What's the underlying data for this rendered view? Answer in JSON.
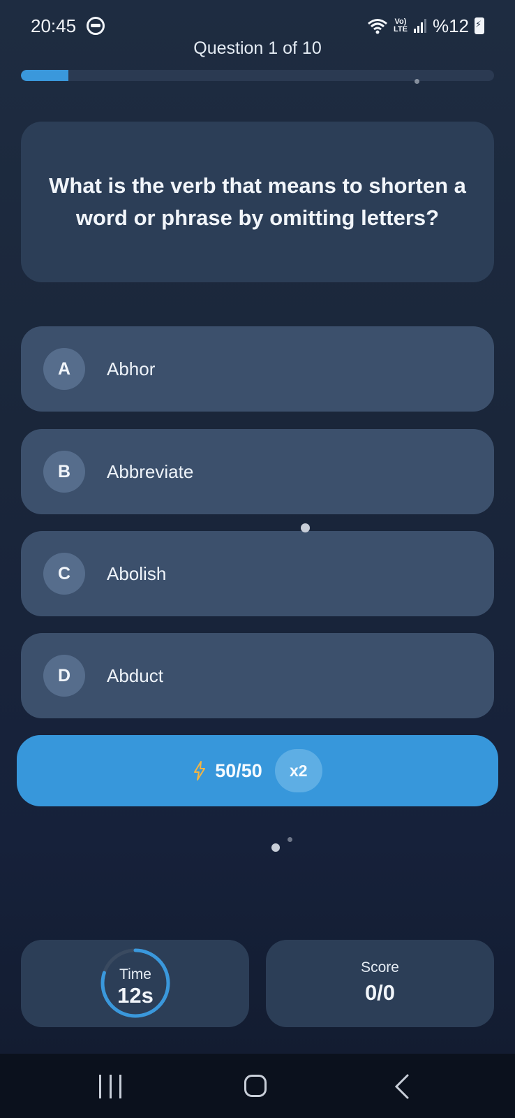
{
  "status_bar": {
    "time": "20:45",
    "network_label": "VoLTE",
    "battery_percent": "%12",
    "icons": [
      "face-icon",
      "wifi-icon",
      "volte-icon",
      "signal-icon",
      "battery-charging-icon"
    ]
  },
  "quiz": {
    "counter": "Question 1 of 10",
    "progress_fraction": 0.1,
    "question": "What is the verb that means to shorten a word or phrase by omitting letters?",
    "options": [
      {
        "letter": "A",
        "text": "Abhor"
      },
      {
        "letter": "B",
        "text": "Abbreviate"
      },
      {
        "letter": "C",
        "text": "Abolish"
      },
      {
        "letter": "D",
        "text": "Abduct"
      }
    ]
  },
  "lifeline": {
    "icon": "lightning-icon",
    "label": "50/50",
    "multiplier": "x2"
  },
  "stats": {
    "time_label": "Time",
    "time_value": "12s",
    "time_remaining_fraction": 0.8,
    "score_label": "Score",
    "score_value": "0/0"
  },
  "colors": {
    "accent": "#3797db",
    "card": "#2c3e57",
    "option": "#3c506c",
    "timer_ring": "#3a98dc",
    "bolt": "#f2b544"
  }
}
